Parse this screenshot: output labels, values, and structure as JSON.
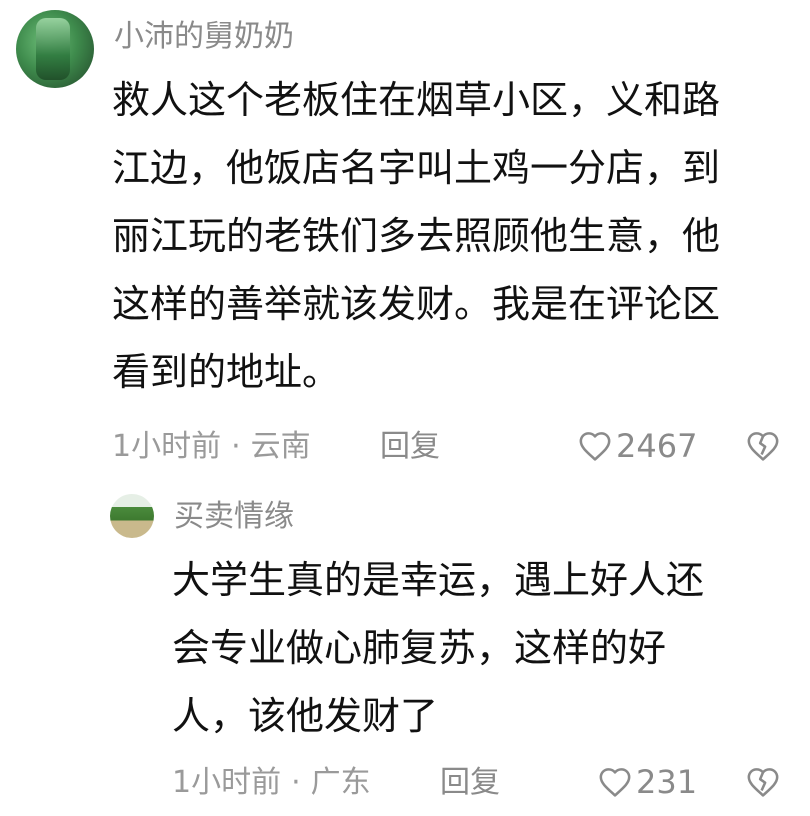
{
  "comments": [
    {
      "username": "小沛的舅奶奶",
      "lines": [
        "救人这个老板住在烟草小区，义和路",
        "江边，他饭店名字叫土鸡一分店，到",
        "丽江玩的老铁们多去照顾他生意，他",
        "这样的善举就该发财。我是在评论区",
        "看到的地址。"
      ],
      "time": "1小时前",
      "separator": "·",
      "location": "云南",
      "reply_label": "回复",
      "likes": "2467",
      "like_icon": "heart-outline-icon",
      "dislike_icon": "broken-heart-icon"
    }
  ],
  "replies": [
    {
      "username": "买卖情缘",
      "lines": [
        "大学生真的是幸运，遇上好人还",
        "会专业做心肺复苏，这样的好",
        "人，该他发财了"
      ],
      "time": "1小时前",
      "separator": "·",
      "location": "广东",
      "reply_label": "回复",
      "likes": "231",
      "like_icon": "heart-outline-icon",
      "dislike_icon": "broken-heart-icon"
    }
  ],
  "colors": {
    "text": "#111111",
    "muted": "#8a8a8a",
    "background": "#ffffff"
  }
}
